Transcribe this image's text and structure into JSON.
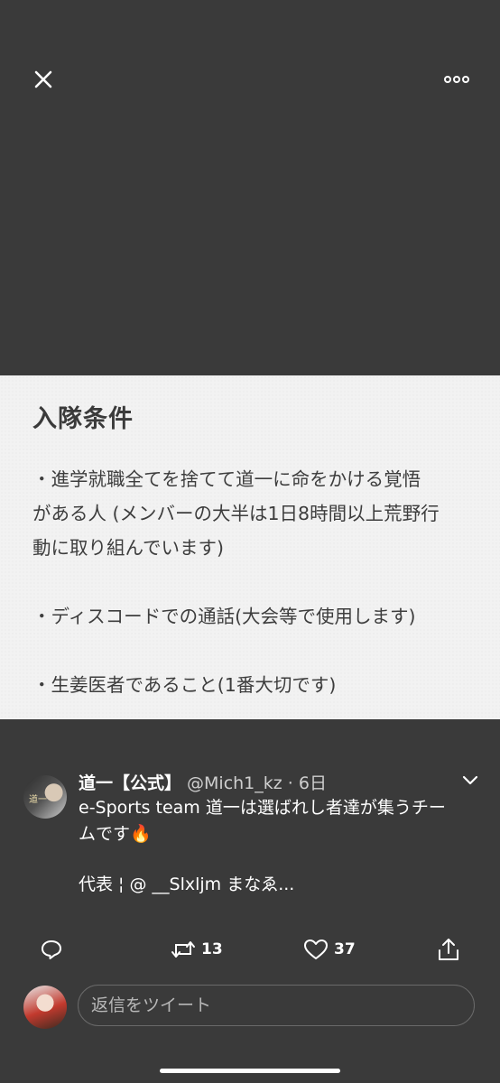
{
  "image": {
    "title": "入隊条件",
    "paragraphs": [
      "・進学就職全てを捨てて道一に命をかける覚悟\nがある人 (メンバーの大半は1日8時間以上荒野行\n動に取り組んでいます)",
      "・ディスコードでの通話(大会等で使用します)",
      "・生姜医者であること(1番大切です)"
    ]
  },
  "tweet": {
    "display_name": "道一【公式】",
    "handle_time": "@Mich1_kz · 6日",
    "text_lines": [
      "e-Sports team 道一は選ばれし者達が集うチー",
      "ムです🔥"
    ],
    "mention_line": "代表 ¦ @ __Slxljm  まなゑ...",
    "avatar_logo": "道一"
  },
  "actions": {
    "retweet_count": "13",
    "like_count": "37"
  },
  "reply": {
    "placeholder": "返信をツイート"
  },
  "icons": {
    "close": "close-icon",
    "more": "more-icon",
    "chevron": "chevron-down-icon",
    "reply": "reply-icon",
    "retweet": "retweet-icon",
    "like": "heart-icon",
    "share": "share-icon"
  },
  "colors": {
    "background": "#3a3a3a",
    "card": "#f2f2f2",
    "text": "#ffffff",
    "muted": "#cfcfcf"
  }
}
